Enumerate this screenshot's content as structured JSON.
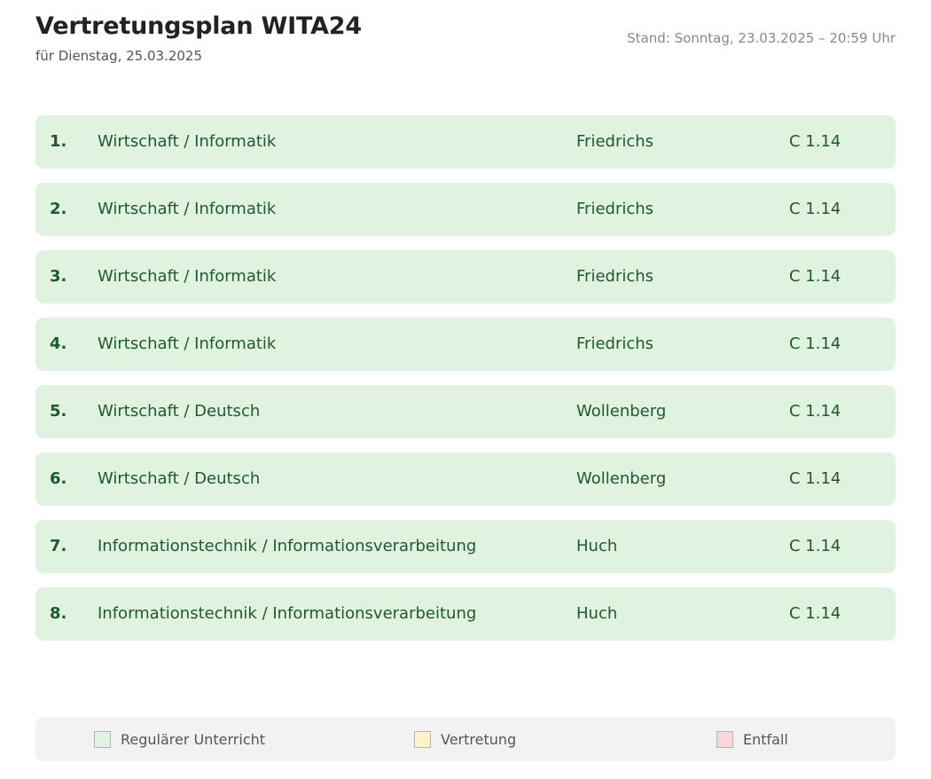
{
  "header": {
    "title": "Vertretungsplan WITA24",
    "subtitle": "für Dienstag, 25.03.2025",
    "stand": "Stand: Sonntag, 23.03.2025 – 20:59 Uhr"
  },
  "rows": [
    {
      "num": "1.",
      "subject": "Wirtschaft / Informatik",
      "teacher": "Friedrichs",
      "room": "C 1.14",
      "status": "regular"
    },
    {
      "num": "2.",
      "subject": "Wirtschaft / Informatik",
      "teacher": "Friedrichs",
      "room": "C 1.14",
      "status": "regular"
    },
    {
      "num": "3.",
      "subject": "Wirtschaft / Informatik",
      "teacher": "Friedrichs",
      "room": "C 1.14",
      "status": "regular"
    },
    {
      "num": "4.",
      "subject": "Wirtschaft / Informatik",
      "teacher": "Friedrichs",
      "room": "C 1.14",
      "status": "regular"
    },
    {
      "num": "5.",
      "subject": "Wirtschaft / Deutsch",
      "teacher": "Wollenberg",
      "room": "C 1.14",
      "status": "regular"
    },
    {
      "num": "6.",
      "subject": "Wirtschaft / Deutsch",
      "teacher": "Wollenberg",
      "room": "C 1.14",
      "status": "regular"
    },
    {
      "num": "7.",
      "subject": "Informationstechnik / Informationsverarbeitung",
      "teacher": "Huch",
      "room": "C 1.14",
      "status": "regular"
    },
    {
      "num": "8.",
      "subject": "Informationstechnik / Informationsverarbeitung",
      "teacher": "Huch",
      "room": "C 1.14",
      "status": "regular"
    }
  ],
  "legend": [
    {
      "label": "Regulärer Unterricht",
      "color": "#dff3e0"
    },
    {
      "label": "Vertretung",
      "color": "#fdf2c8"
    },
    {
      "label": "Entfall",
      "color": "#f8d7da"
    }
  ],
  "colors": {
    "regular_bg": "#dff3e0",
    "regular_text": "#1f5a2a"
  }
}
